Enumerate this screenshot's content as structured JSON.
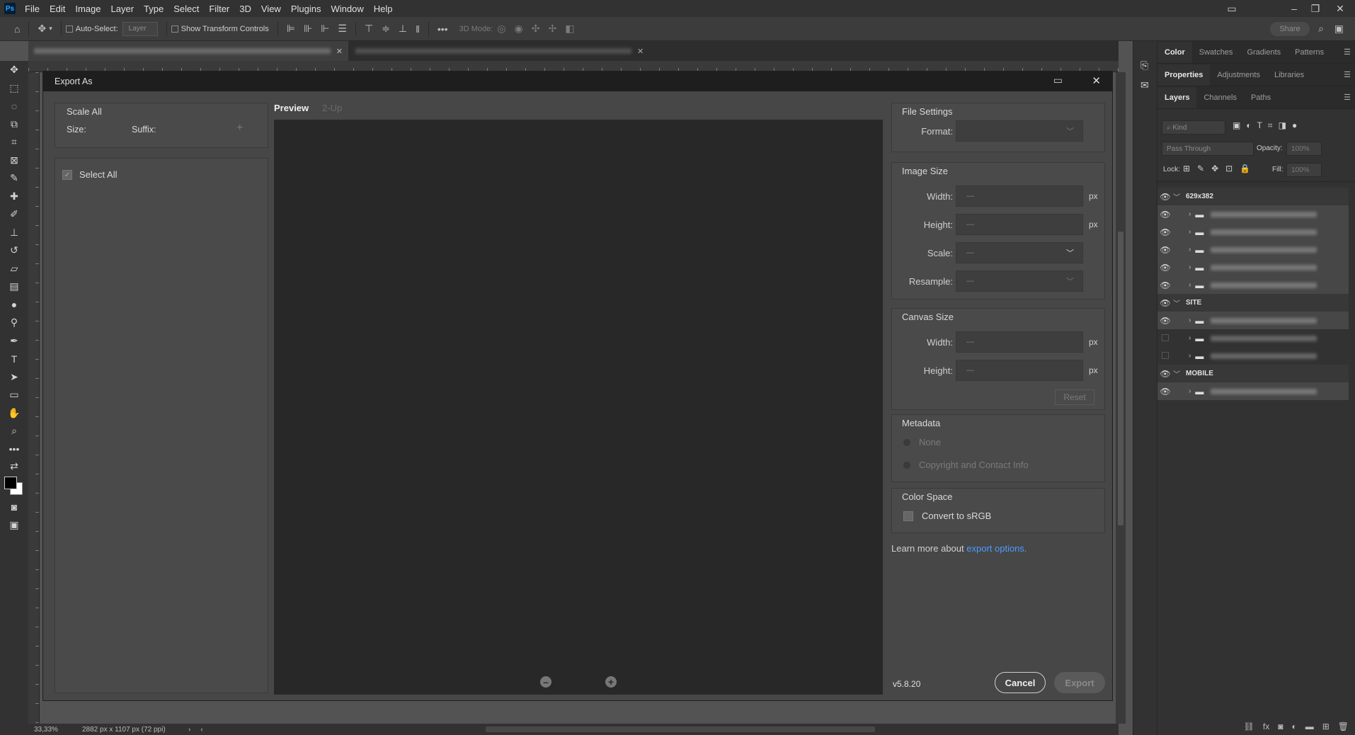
{
  "menu": {
    "items": [
      "File",
      "Edit",
      "Image",
      "Layer",
      "Type",
      "Select",
      "Filter",
      "3D",
      "View",
      "Plugins",
      "Window",
      "Help"
    ]
  },
  "options": {
    "auto_select": "Auto-Select:",
    "layer_dropdown": "Layer",
    "show_transform": "Show Transform Controls",
    "mode_3d": "3D Mode:",
    "share": "Share"
  },
  "status": {
    "zoom": "33,33%",
    "size": "2882 px x 1107 px (72 ppi)"
  },
  "dialog": {
    "title": "Export As",
    "left": {
      "scale_all": "Scale All",
      "size": "Size:",
      "suffix": "Suffix:",
      "select_all": "Select All"
    },
    "preview": {
      "tab1": "Preview",
      "tab2": "2-Up"
    },
    "file_settings": {
      "heading": "File Settings",
      "format": "Format:"
    },
    "image_size": {
      "heading": "Image Size",
      "width": "Width:",
      "height": "Height:",
      "scale": "Scale:",
      "resample": "Resample:",
      "unit": "px",
      "placeholder": "—"
    },
    "canvas_size": {
      "heading": "Canvas Size",
      "width": "Width:",
      "height": "Height:",
      "reset": "Reset"
    },
    "metadata": {
      "heading": "Metadata",
      "none": "None",
      "copyright": "Copyright and Contact Info"
    },
    "color_space": {
      "heading": "Color Space",
      "convert": "Convert to sRGB"
    },
    "learn": {
      "text": "Learn more about",
      "link": "export options."
    },
    "version": "v5.8.20",
    "cancel": "Cancel",
    "export": "Export"
  },
  "right_panel": {
    "tabs1": [
      "Color",
      "Swatches",
      "Gradients",
      "Patterns"
    ],
    "tabs2": [
      "Properties",
      "Adjustments",
      "Libraries"
    ],
    "tabs3": [
      "Layers",
      "Channels",
      "Paths"
    ],
    "kind": "Kind",
    "blend": "Pass Through",
    "opacity_label": "Opacity:",
    "opacity": "100%",
    "lock": "Lock:",
    "fill_label": "Fill:",
    "fill": "100%",
    "groups": [
      "629x382",
      "SITE",
      "MOBILE"
    ]
  }
}
